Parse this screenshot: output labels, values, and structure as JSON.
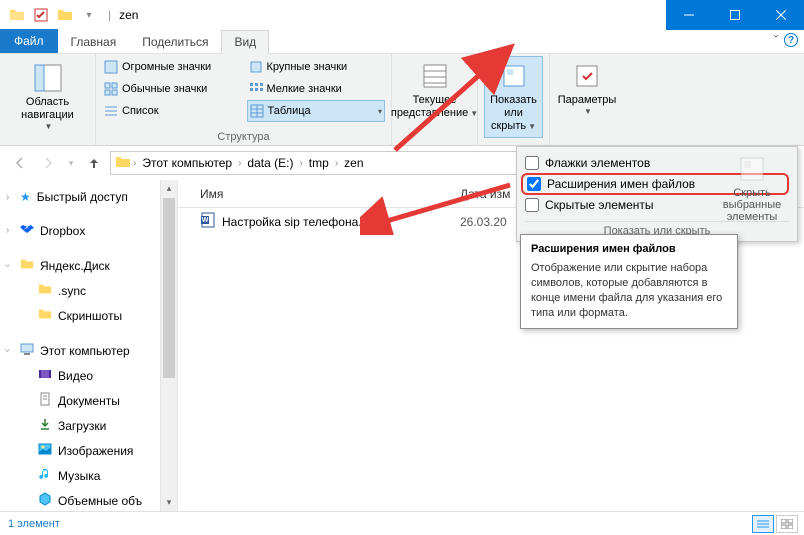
{
  "window": {
    "title": "zen",
    "controls": {
      "min": "—",
      "max": "☐",
      "close": "✕"
    }
  },
  "tabs": {
    "file": "Файл",
    "items": [
      "Главная",
      "Поделиться",
      "Вид"
    ],
    "active_index": 2
  },
  "ribbon": {
    "group_nav": {
      "label": "Область навигации",
      "group": ""
    },
    "group_layout_items": [
      "Огромные значки",
      "Крупные значки",
      "Обычные значки",
      "Мелкие значки",
      "Список",
      "Таблица"
    ],
    "group_layout_label": "Структура",
    "current_view": {
      "label1": "Текущее",
      "label2": "представление"
    },
    "show_hide": {
      "label1": "Показать",
      "label2": "или скрыть"
    },
    "options": "Параметры"
  },
  "breadcrumbs": [
    "Этот компьютер",
    "data (E:)",
    "tmp",
    "zen"
  ],
  "nav": {
    "quick": "Быстрый доступ",
    "dropbox": "Dropbox",
    "yadisk": "Яндекс.Диск",
    "sync": ".sync",
    "screenshots": "Скриншоты",
    "thispc": "Этот компьютер",
    "video": "Видео",
    "documents": "Документы",
    "downloads": "Загрузки",
    "pictures": "Изображения",
    "music": "Музыка",
    "volumes": "Объемные объ"
  },
  "columns": {
    "name": "Имя",
    "date": "Дата изм"
  },
  "files": [
    {
      "name": "Настройка sip телефона.docx",
      "date": "26.03.20"
    }
  ],
  "showhide": {
    "checkboxes": "Флажки элементов",
    "extensions": "Расширения имен файлов",
    "hidden": "Скрытые элементы",
    "hide_selected1": "Скрыть выбранные",
    "hide_selected2": "элементы",
    "footer": "Показать или скрыть"
  },
  "tooltip": {
    "title": "Расширения имен файлов",
    "body": "Отображение или скрытие набора символов, которые добавляются в конце имени файла для указания его типа или формата."
  },
  "status": {
    "count": "1 элемент"
  }
}
